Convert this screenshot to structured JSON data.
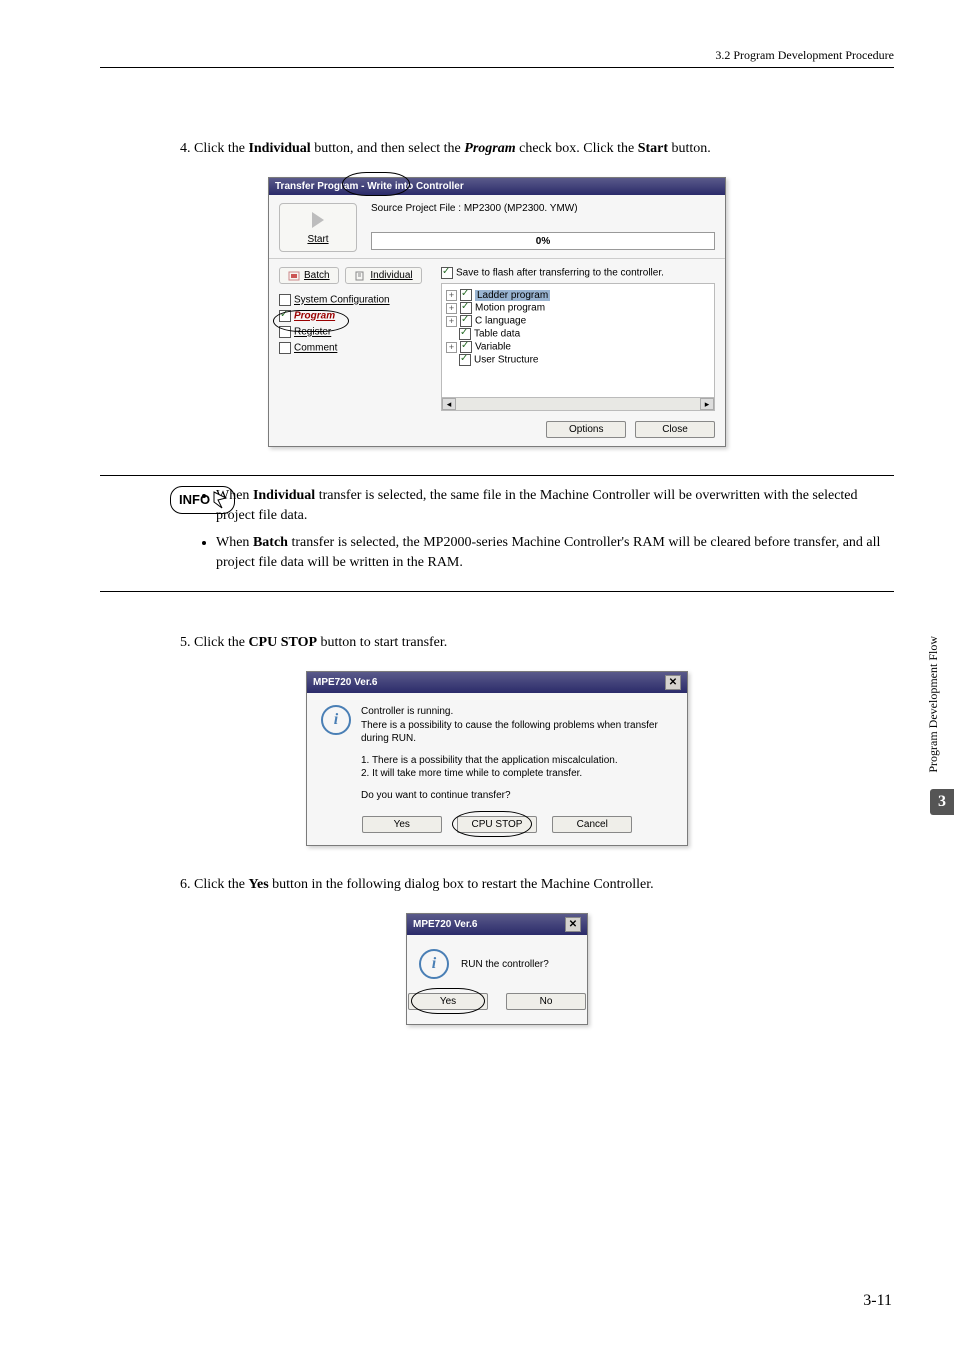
{
  "header": {
    "section": "3.2  Program Development Procedure"
  },
  "steps": {
    "s4_num": "4.",
    "s4_a": "Click the ",
    "s4_b": "Individual",
    "s4_c": " button, and then select the ",
    "s4_d": "Program",
    "s4_e": " check box. Click the ",
    "s4_f": "Start",
    "s4_g": " button.",
    "s5_num": "5.",
    "s5_a": "Click the ",
    "s5_b": "CPU STOP",
    "s5_c": " button to start transfer.",
    "s6_num": "6.",
    "s6_a": "Click the ",
    "s6_b": "Yes",
    "s6_c": " button in the following dialog box to restart the Machine Controller."
  },
  "info": {
    "label": "INFO",
    "b1_a": "When ",
    "b1_b": "Individual",
    "b1_c": " transfer is selected, the same file in the Machine Controller will be overwritten with the selected project file data.",
    "b2_a": "When ",
    "b2_b": "Batch",
    "b2_c": " transfer is selected, the MP2000-series Machine Controller's RAM will be cleared before transfer, and all project file data will be written in the RAM."
  },
  "fig1": {
    "title": "Transfer Program - Write into Controller",
    "source": "Source Project File : MP2300     (MP2300. YMW)",
    "start": "Start",
    "progress": "0%",
    "batch": "Batch",
    "individual": "Individual",
    "save_flash": "Save to flash after transferring to the controller.",
    "left_sysconf": "System Configuration",
    "left_program": "Program",
    "left_register": "Register",
    "left_comment": "Comment",
    "tree": {
      "ladder": "Ladder program",
      "motion": "Motion program",
      "clang": "C language",
      "table": "Table data",
      "variable": "Variable",
      "userstruct": "User Structure"
    },
    "options": "Options",
    "close": "Close"
  },
  "fig2": {
    "title": "MPE720 Ver.6",
    "l1": "Controller is running.",
    "l2": "There is a possibility to cause the following problems when transfer during RUN.",
    "l3": "1. There is a possibility that the application miscalculation.",
    "l4": "2. It will take more time while to complete transfer.",
    "l5": "Do you want to continue transfer?",
    "yes": "Yes",
    "cpu": "CPU STOP",
    "cancel": "Cancel"
  },
  "fig3": {
    "title": "MPE720 Ver.6",
    "msg": "RUN the controller?",
    "yes": "Yes",
    "no": "No"
  },
  "side": {
    "label": "Program Development Flow",
    "chapter": "3"
  },
  "footer": {
    "page": "3-11"
  }
}
